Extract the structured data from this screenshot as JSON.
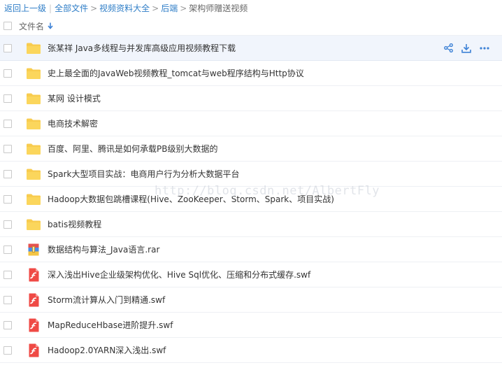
{
  "breadcrumb": {
    "back": "返回上一级",
    "all_files": "全部文件",
    "level1": "视频资料大全",
    "level2": "后端",
    "current": "架构师赠送视频",
    "separator": ">",
    "divider": "|"
  },
  "list_header": {
    "column_name": "文件名"
  },
  "files": [
    {
      "name": "张某祥 Java多线程与并发库高级应用视频教程下载",
      "type": "folder-icon"
    },
    {
      "name": "史上最全面的JavaWeb视频教程_tomcat与web程序结构与Http协议",
      "type": "folder-icon"
    },
    {
      "name": "某网 设计模式",
      "type": "folder-icon"
    },
    {
      "name": "电商技术解密",
      "type": "folder-icon"
    },
    {
      "name": "百度、阿里、腾讯是如何承载PB级别大数据的",
      "type": "folder-icon"
    },
    {
      "name": "Spark大型项目实战：电商用户行为分析大数据平台",
      "type": "folder-icon"
    },
    {
      "name": "Hadoop大数据包跳槽课程(Hive、ZooKeeper、Storm、Spark、项目实战)",
      "type": "folder-icon"
    },
    {
      "name": "batis视频教程",
      "type": "folder-icon"
    },
    {
      "name": "数据结构与算法_Java语言.rar",
      "type": "archive-icon"
    },
    {
      "name": "深入浅出Hive企业级架构优化、Hive Sql优化、压缩和分布式缓存.swf",
      "type": "flash-icon"
    },
    {
      "name": "Storm流计算从入门到精通.swf",
      "type": "flash-icon"
    },
    {
      "name": "MapReduceHbase进阶提升.swf",
      "type": "flash-icon"
    },
    {
      "name": "Hadoop2.0YARN深入浅出.swf",
      "type": "flash-icon"
    }
  ],
  "hover_actions": [
    "share-icon",
    "download-icon",
    "more-icon"
  ],
  "watermark": "http://blog.csdn.net/AlbertFly",
  "colors": {
    "link": "#2f7ec7",
    "folder": "#f8cc4f",
    "flash": "#ef4a45",
    "hover_row": "#f1f5fc",
    "action_icon": "#3e82d6"
  }
}
